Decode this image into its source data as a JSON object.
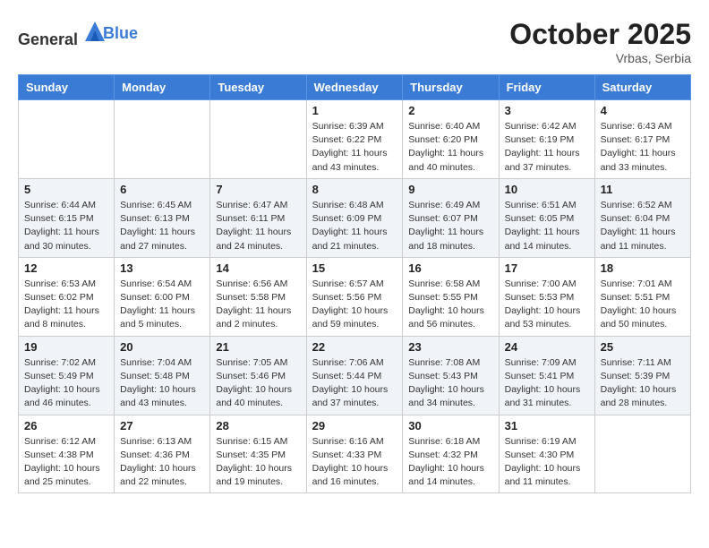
{
  "header": {
    "logo_general": "General",
    "logo_blue": "Blue",
    "month_title": "October 2025",
    "subtitle": "Vrbas, Serbia"
  },
  "weekdays": [
    "Sunday",
    "Monday",
    "Tuesday",
    "Wednesday",
    "Thursday",
    "Friday",
    "Saturday"
  ],
  "weeks": [
    [
      {
        "day": "",
        "info": ""
      },
      {
        "day": "",
        "info": ""
      },
      {
        "day": "",
        "info": ""
      },
      {
        "day": "1",
        "info": "Sunrise: 6:39 AM\nSunset: 6:22 PM\nDaylight: 11 hours\nand 43 minutes."
      },
      {
        "day": "2",
        "info": "Sunrise: 6:40 AM\nSunset: 6:20 PM\nDaylight: 11 hours\nand 40 minutes."
      },
      {
        "day": "3",
        "info": "Sunrise: 6:42 AM\nSunset: 6:19 PM\nDaylight: 11 hours\nand 37 minutes."
      },
      {
        "day": "4",
        "info": "Sunrise: 6:43 AM\nSunset: 6:17 PM\nDaylight: 11 hours\nand 33 minutes."
      }
    ],
    [
      {
        "day": "5",
        "info": "Sunrise: 6:44 AM\nSunset: 6:15 PM\nDaylight: 11 hours\nand 30 minutes."
      },
      {
        "day": "6",
        "info": "Sunrise: 6:45 AM\nSunset: 6:13 PM\nDaylight: 11 hours\nand 27 minutes."
      },
      {
        "day": "7",
        "info": "Sunrise: 6:47 AM\nSunset: 6:11 PM\nDaylight: 11 hours\nand 24 minutes."
      },
      {
        "day": "8",
        "info": "Sunrise: 6:48 AM\nSunset: 6:09 PM\nDaylight: 11 hours\nand 21 minutes."
      },
      {
        "day": "9",
        "info": "Sunrise: 6:49 AM\nSunset: 6:07 PM\nDaylight: 11 hours\nand 18 minutes."
      },
      {
        "day": "10",
        "info": "Sunrise: 6:51 AM\nSunset: 6:05 PM\nDaylight: 11 hours\nand 14 minutes."
      },
      {
        "day": "11",
        "info": "Sunrise: 6:52 AM\nSunset: 6:04 PM\nDaylight: 11 hours\nand 11 minutes."
      }
    ],
    [
      {
        "day": "12",
        "info": "Sunrise: 6:53 AM\nSunset: 6:02 PM\nDaylight: 11 hours\nand 8 minutes."
      },
      {
        "day": "13",
        "info": "Sunrise: 6:54 AM\nSunset: 6:00 PM\nDaylight: 11 hours\nand 5 minutes."
      },
      {
        "day": "14",
        "info": "Sunrise: 6:56 AM\nSunset: 5:58 PM\nDaylight: 11 hours\nand 2 minutes."
      },
      {
        "day": "15",
        "info": "Sunrise: 6:57 AM\nSunset: 5:56 PM\nDaylight: 10 hours\nand 59 minutes."
      },
      {
        "day": "16",
        "info": "Sunrise: 6:58 AM\nSunset: 5:55 PM\nDaylight: 10 hours\nand 56 minutes."
      },
      {
        "day": "17",
        "info": "Sunrise: 7:00 AM\nSunset: 5:53 PM\nDaylight: 10 hours\nand 53 minutes."
      },
      {
        "day": "18",
        "info": "Sunrise: 7:01 AM\nSunset: 5:51 PM\nDaylight: 10 hours\nand 50 minutes."
      }
    ],
    [
      {
        "day": "19",
        "info": "Sunrise: 7:02 AM\nSunset: 5:49 PM\nDaylight: 10 hours\nand 46 minutes."
      },
      {
        "day": "20",
        "info": "Sunrise: 7:04 AM\nSunset: 5:48 PM\nDaylight: 10 hours\nand 43 minutes."
      },
      {
        "day": "21",
        "info": "Sunrise: 7:05 AM\nSunset: 5:46 PM\nDaylight: 10 hours\nand 40 minutes."
      },
      {
        "day": "22",
        "info": "Sunrise: 7:06 AM\nSunset: 5:44 PM\nDaylight: 10 hours\nand 37 minutes."
      },
      {
        "day": "23",
        "info": "Sunrise: 7:08 AM\nSunset: 5:43 PM\nDaylight: 10 hours\nand 34 minutes."
      },
      {
        "day": "24",
        "info": "Sunrise: 7:09 AM\nSunset: 5:41 PM\nDaylight: 10 hours\nand 31 minutes."
      },
      {
        "day": "25",
        "info": "Sunrise: 7:11 AM\nSunset: 5:39 PM\nDaylight: 10 hours\nand 28 minutes."
      }
    ],
    [
      {
        "day": "26",
        "info": "Sunrise: 6:12 AM\nSunset: 4:38 PM\nDaylight: 10 hours\nand 25 minutes."
      },
      {
        "day": "27",
        "info": "Sunrise: 6:13 AM\nSunset: 4:36 PM\nDaylight: 10 hours\nand 22 minutes."
      },
      {
        "day": "28",
        "info": "Sunrise: 6:15 AM\nSunset: 4:35 PM\nDaylight: 10 hours\nand 19 minutes."
      },
      {
        "day": "29",
        "info": "Sunrise: 6:16 AM\nSunset: 4:33 PM\nDaylight: 10 hours\nand 16 minutes."
      },
      {
        "day": "30",
        "info": "Sunrise: 6:18 AM\nSunset: 4:32 PM\nDaylight: 10 hours\nand 14 minutes."
      },
      {
        "day": "31",
        "info": "Sunrise: 6:19 AM\nSunset: 4:30 PM\nDaylight: 10 hours\nand 11 minutes."
      },
      {
        "day": "",
        "info": ""
      }
    ]
  ]
}
